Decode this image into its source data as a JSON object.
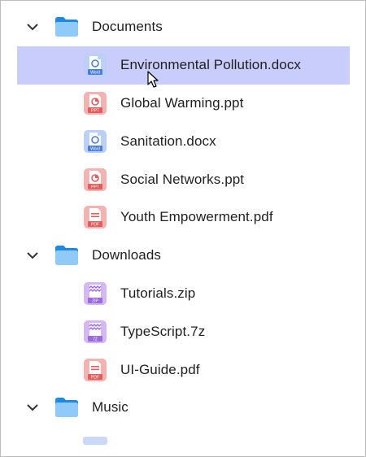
{
  "tree": {
    "folders": [
      {
        "name": "Documents",
        "files": [
          {
            "name": "Environmental Pollution.docx",
            "type": "word",
            "badge": "Word",
            "selected": true
          },
          {
            "name": "Global Warming.ppt",
            "type": "ppt",
            "badge": "PPT"
          },
          {
            "name": "Sanitation.docx",
            "type": "word",
            "badge": "Word"
          },
          {
            "name": "Social Networks.ppt",
            "type": "ppt",
            "badge": "PPT"
          },
          {
            "name": "Youth Empowerment.pdf",
            "type": "pdf",
            "badge": "PDF"
          }
        ]
      },
      {
        "name": "Downloads",
        "files": [
          {
            "name": "Tutorials.zip",
            "type": "zip",
            "badge": "ZIP"
          },
          {
            "name": "TypeScript.7z",
            "type": "zip",
            "badge": "7Z"
          },
          {
            "name": "UI-Guide.pdf",
            "type": "pdf",
            "badge": "PDF"
          }
        ]
      },
      {
        "name": "Music",
        "files": []
      }
    ]
  },
  "colors": {
    "selection": "#c9cdfb",
    "folder_back": "#1e88e5",
    "folder_front": "#90caf9",
    "word": "#4a7ede",
    "ppt": "#e35d5d",
    "pdf": "#e35d5d",
    "zip": "#9c6ade"
  },
  "icons": {
    "chevron": "chevron-down-icon",
    "folder": "folder-icon",
    "word": "word-file-icon",
    "ppt": "ppt-file-icon",
    "pdf": "pdf-file-icon",
    "zip": "zip-file-icon",
    "cursor": "mouse-pointer-icon"
  }
}
